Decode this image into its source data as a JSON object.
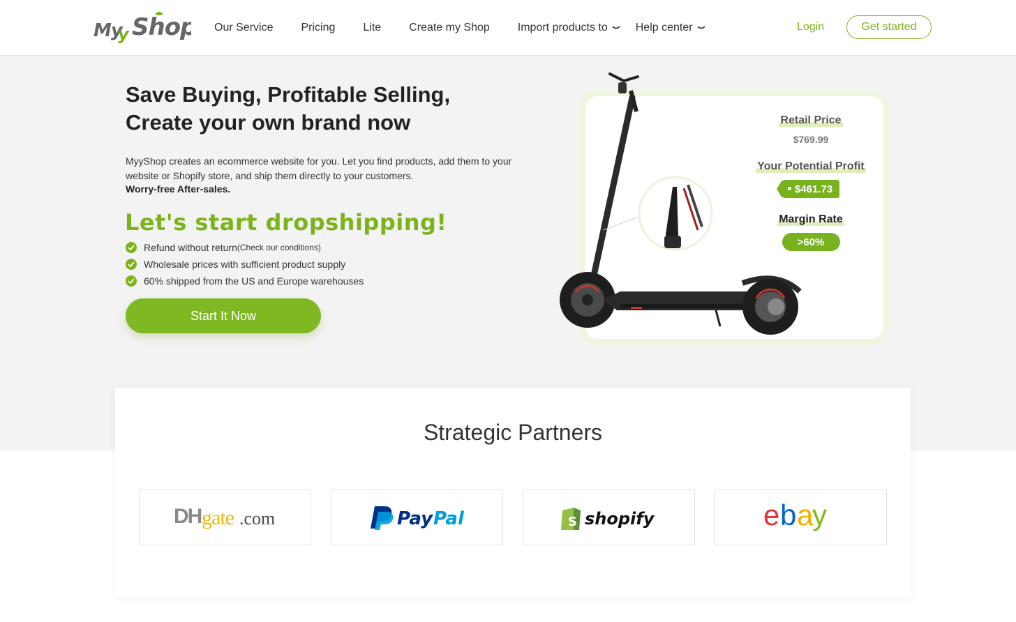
{
  "header": {
    "logo_text": "MyyShop",
    "nav": [
      {
        "label": "Our Service"
      },
      {
        "label": "Pricing"
      },
      {
        "label": "Lite"
      },
      {
        "label": "Create my Shop"
      },
      {
        "label": "Import products to",
        "dropdown": true
      },
      {
        "label": "Help center",
        "dropdown": true
      }
    ],
    "login": "Login",
    "get_started": "Get started"
  },
  "hero": {
    "title_line1": "Save Buying, Profitable Selling,",
    "title_line2": "Create your own brand now",
    "description": "MyyShop creates an ecommerce website for you. Let you find products, add them to your website or Shopify store, and ship them directly to your customers.",
    "strong": "Worry-free After-sales.",
    "dropship_heading": "Let's start dropshipping!",
    "checks": [
      {
        "text": "Refund without return",
        "small": "(Check our conditions)"
      },
      {
        "text": "Wholesale prices with sufficient product supply",
        "small": ""
      },
      {
        "text": "60% shipped from the US and Europe warehouses",
        "small": ""
      }
    ],
    "cta": "Start It Now"
  },
  "product_card": {
    "retail_label": "Retail Price",
    "retail_value": "$769.99",
    "profit_label": "Your Potential Profit",
    "profit_value": "$461.73",
    "margin_label": "Margin Rate",
    "margin_value": ">60%"
  },
  "partners": {
    "title": "Strategic Partners",
    "logos": [
      {
        "name": "DHgate.com",
        "parts": [
          "DH",
          "gate",
          ".com"
        ]
      },
      {
        "name": "PayPal",
        "parts": [
          "Pay",
          "Pal"
        ]
      },
      {
        "name": "shopify",
        "parts": [
          "shopify"
        ]
      },
      {
        "name": "ebay",
        "parts": [
          "e",
          "b",
          "a",
          "y"
        ]
      }
    ]
  },
  "colors": {
    "brand_green": "#7cb31c",
    "hero_bg": "#f3f3f3",
    "paypal_dark": "#003087",
    "paypal_light": "#009cde",
    "shopify_green": "#95bf47",
    "ebay_red": "#e53238",
    "ebay_blue": "#0064d2",
    "ebay_yellow": "#f5af02",
    "ebay_green": "#86b817",
    "dhgate_gold": "#f1b600"
  }
}
